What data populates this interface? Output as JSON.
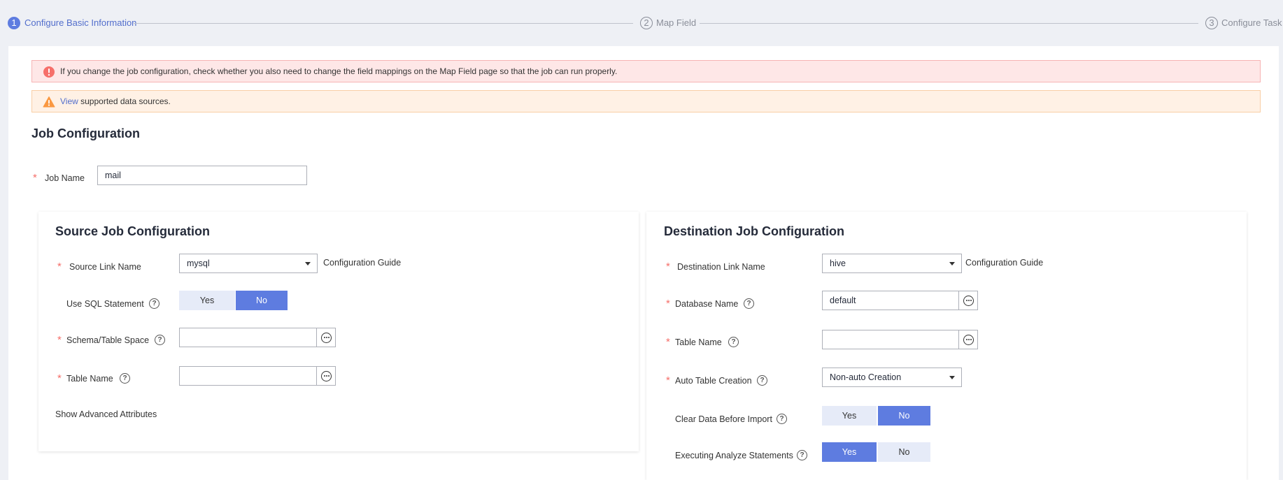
{
  "stepper": {
    "steps": [
      {
        "number": "1",
        "label": "Configure Basic Information"
      },
      {
        "number": "2",
        "label": "Map Field"
      },
      {
        "number": "3",
        "label": "Configure Task"
      }
    ]
  },
  "alerts": {
    "error_text": "If you change the job configuration, check whether you also need to change the field mappings on the Map Field page so that the job can run properly.",
    "warn_link": "View",
    "warn_text": " supported data sources."
  },
  "job": {
    "section_title": "Job Configuration",
    "name_label": "Job Name",
    "name_value": "mail"
  },
  "source": {
    "title": "Source Job Configuration",
    "link_label": "Source Link Name",
    "link_value": "mysql",
    "config_guide": "Configuration Guide",
    "sql_label": "Use SQL Statement",
    "sql_yes": "Yes",
    "sql_no": "No",
    "schema_label": "Schema/Table Space",
    "schema_value": "",
    "table_label": "Table Name",
    "table_value": "",
    "advanced": "Show Advanced Attributes"
  },
  "destination": {
    "title": "Destination Job Configuration",
    "link_label": "Destination Link Name",
    "link_value": "hive",
    "config_guide": "Configuration Guide",
    "db_label": "Database Name",
    "db_value": "default",
    "table_label": "Table Name",
    "table_value": "",
    "auto_label": "Auto Table Creation",
    "auto_value": "Non-auto Creation",
    "clear_label": "Clear Data Before Import",
    "clear_yes": "Yes",
    "clear_no": "No",
    "analyze_label": "Executing Analyze Statements",
    "analyze_yes": "Yes",
    "analyze_no": "No"
  },
  "colors": {
    "accent": "#5e7ce0",
    "link": "#526ecc",
    "required": "#f66f6a",
    "error_bg": "#fee7e7",
    "warn_bg": "#fff1e5",
    "page_bg": "#eef0f5"
  },
  "icons": {
    "error": "error-circle-icon",
    "warning": "warning-triangle-icon",
    "help": "help-circle-icon",
    "more": "more-dots-icon",
    "dropdown": "chevron-down-icon"
  }
}
